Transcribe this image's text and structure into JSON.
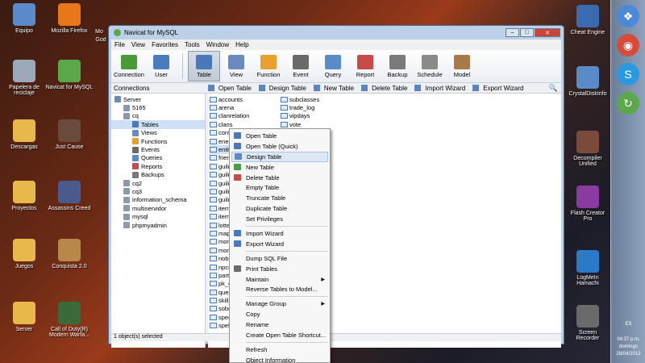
{
  "desktop": {
    "icons": [
      {
        "label": "Equipo",
        "icon": "computer-icon",
        "color": "#5a8ac8"
      },
      {
        "label": "Mozilla Firefox",
        "icon": "firefox-icon",
        "color": "#e8761a"
      },
      {
        "label": "Papelera de reciclaje",
        "icon": "recycle-bin-icon",
        "color": "#9aa8b8"
      },
      {
        "label": "Navicat for MySQL",
        "icon": "navicat-icon",
        "color": "#5aa84a"
      },
      {
        "label": "Descargas",
        "icon": "folder-icon",
        "color": "#e8b84a"
      },
      {
        "label": "Just Cause",
        "icon": "game-icon",
        "color": "#6a4a3a"
      },
      {
        "label": "Proyectos",
        "icon": "folder-icon",
        "color": "#e8b84a"
      },
      {
        "label": "Assassins Creed",
        "icon": "game-icon",
        "color": "#4a5a8a"
      },
      {
        "label": "Juegos",
        "icon": "folder-icon",
        "color": "#e8b84a"
      },
      {
        "label": "Conquista 2.0",
        "icon": "game-icon",
        "color": "#b8884a"
      },
      {
        "label": "Server",
        "icon": "folder-icon",
        "color": "#e8b84a"
      },
      {
        "label": "Call of Duty(R) Modern Warfa...",
        "icon": "game-icon",
        "color": "#3a6a3a"
      }
    ],
    "partial_labels": [
      "Mo",
      "God"
    ]
  },
  "taskbar": {
    "time": "04:37 p.m.",
    "day": "domingo",
    "date": "28/04/2013",
    "lang": "ES",
    "right_labels": [
      "Cheat Engine",
      "CrystalDiskInfo",
      "Decompiler Unified",
      "Flash Creator Pro",
      "LogMeIn Hamachi",
      "Screen Recorder"
    ]
  },
  "window": {
    "title": "Navicat for MySQL",
    "menu": [
      "File",
      "View",
      "Favorites",
      "Tools",
      "Window",
      "Help"
    ],
    "toolbar": [
      {
        "label": "Connection",
        "icon": "plug-icon",
        "color": "#4a9a3a"
      },
      {
        "label": "User",
        "icon": "user-icon",
        "color": "#4a7ac0"
      },
      {
        "label": "Table",
        "icon": "table-icon",
        "color": "#4a78b8",
        "active": true
      },
      {
        "label": "View",
        "icon": "view-icon",
        "color": "#6a8ac0"
      },
      {
        "label": "Function",
        "icon": "function-icon",
        "color": "#e8a030"
      },
      {
        "label": "Event",
        "icon": "clock-icon",
        "color": "#6a6a6a"
      },
      {
        "label": "Query",
        "icon": "query-icon",
        "color": "#5a8ac8"
      },
      {
        "label": "Report",
        "icon": "report-icon",
        "color": "#c84a4a"
      },
      {
        "label": "Backup",
        "icon": "backup-icon",
        "color": "#7a7a7a"
      },
      {
        "label": "Schedule",
        "icon": "calendar-icon",
        "color": "#8a8a8a"
      },
      {
        "label": "Model",
        "icon": "model-icon",
        "color": "#a87a4a"
      }
    ],
    "connections_label": "Connections",
    "subtools": [
      "Open Table",
      "Design Table",
      "New Table",
      "Delete Table",
      "Import Wizard",
      "Export Wizard"
    ],
    "tree": [
      {
        "label": "Server",
        "indent": 0,
        "icon": "server-icon"
      },
      {
        "label": "5165",
        "indent": 1,
        "icon": "database-icon"
      },
      {
        "label": "cq",
        "indent": 1,
        "icon": "database-icon"
      },
      {
        "label": "Tables",
        "indent": 2,
        "icon": "tables-icon",
        "selected": true
      },
      {
        "label": "Views",
        "indent": 2,
        "icon": "views-icon"
      },
      {
        "label": "Functions",
        "indent": 2,
        "icon": "functions-icon"
      },
      {
        "label": "Events",
        "indent": 2,
        "icon": "events-icon"
      },
      {
        "label": "Queries",
        "indent": 2,
        "icon": "queries-icon"
      },
      {
        "label": "Reports",
        "indent": 2,
        "icon": "reports-icon"
      },
      {
        "label": "Backups",
        "indent": 2,
        "icon": "backups-icon"
      },
      {
        "label": "cq2",
        "indent": 1,
        "icon": "database-icon"
      },
      {
        "label": "cq3",
        "indent": 1,
        "icon": "database-icon"
      },
      {
        "label": "information_schema",
        "indent": 1,
        "icon": "database-icon"
      },
      {
        "label": "multiservidor",
        "indent": 1,
        "icon": "database-icon"
      },
      {
        "label": "mysql",
        "indent": 1,
        "icon": "database-icon"
      },
      {
        "label": "phpmyadmin",
        "indent": 1,
        "icon": "database-icon"
      }
    ],
    "tables_col1": [
      "accounts",
      "arena",
      "clanrelation",
      "clans",
      "conf",
      "ener",
      "entit",
      "frien",
      "guild",
      "guild",
      "guild",
      "guild",
      "guild",
      "item",
      "item",
      "lotte",
      "map",
      "mon",
      "mon",
      "nobi",
      "npcs",
      "partn",
      "pk_e",
      "ques",
      "skills",
      "sobn",
      "spec",
      "spell"
    ],
    "tables_col2": [
      "subclasses",
      "trade_log",
      "vipdays",
      "vote"
    ],
    "status": "1 object(s) selected"
  },
  "context_menu": [
    {
      "label": "Open Table",
      "icon": "open-table-icon"
    },
    {
      "label": "Open Table (Quick)",
      "icon": "open-table-quick-icon"
    },
    {
      "label": "Design Table",
      "icon": "design-table-icon",
      "highlighted": true
    },
    {
      "label": "New Table",
      "icon": "new-table-icon"
    },
    {
      "label": "Delete Table",
      "icon": "delete-table-icon"
    },
    {
      "label": "Empty Table"
    },
    {
      "label": "Truncate Table"
    },
    {
      "label": "Duplicate Table"
    },
    {
      "label": "Set Privileges"
    },
    {
      "separator": true
    },
    {
      "label": "Import Wizard",
      "icon": "import-icon"
    },
    {
      "label": "Export Wizard",
      "icon": "export-icon"
    },
    {
      "separator": true
    },
    {
      "label": "Dump SQL File"
    },
    {
      "label": "Print Tables",
      "icon": "print-icon"
    },
    {
      "label": "Maintain",
      "submenu": true
    },
    {
      "label": "Reverse Tables to Model..."
    },
    {
      "separator": true
    },
    {
      "label": "Manage Group",
      "submenu": true
    },
    {
      "label": "Copy"
    },
    {
      "label": "Rename"
    },
    {
      "label": "Create Open Table Shortcut..."
    },
    {
      "separator": true
    },
    {
      "label": "Refresh"
    },
    {
      "label": "Object Information"
    }
  ]
}
